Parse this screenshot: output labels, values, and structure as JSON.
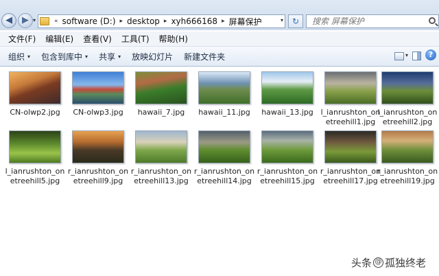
{
  "window": {
    "minimize": "–",
    "maximize": "□",
    "close": "✕"
  },
  "nav": {
    "back_glyph": "◀",
    "forward_glyph": "▶",
    "history_glyph": "▾"
  },
  "address": {
    "prefix": "«",
    "crumbs": [
      "software (D:)",
      "desktop",
      "xyh666168",
      "屏幕保护"
    ],
    "separator": "▸",
    "dropdown_glyph": "▾"
  },
  "refresh_glyph": "↻",
  "search": {
    "placeholder": "搜索 屏幕保护"
  },
  "menu": [
    "文件(F)",
    "编辑(E)",
    "查看(V)",
    "工具(T)",
    "帮助(H)"
  ],
  "toolbar": {
    "organize": "组织",
    "include_in_library": "包含到库中",
    "share": "共享",
    "slideshow": "放映幻灯片",
    "new_folder": "新建文件夹",
    "caret": "▾",
    "help_glyph": "?"
  },
  "files": [
    {
      "name": "CN-olwp2.jpg",
      "thumb": "t1"
    },
    {
      "name": "CN-olwp3.jpg",
      "thumb": "t2"
    },
    {
      "name": "hawaii_7.jpg",
      "thumb": "t3"
    },
    {
      "name": "hawaii_11.jpg",
      "thumb": "t4"
    },
    {
      "name": "hawaii_13.jpg",
      "thumb": "t5"
    },
    {
      "name": "l_ianrushton_onetreehill1.jpg",
      "thumb": "t6"
    },
    {
      "name": "l_ianrushton_onetreehill2.jpg",
      "thumb": "t7"
    },
    {
      "name": "l_ianrushton_onetreehill5.jpg",
      "thumb": "t8"
    },
    {
      "name": "r_ianrushton_onetreehill9.jpg",
      "thumb": "t9"
    },
    {
      "name": "r_ianrushton_onetreehill13.jpg",
      "thumb": "t10"
    },
    {
      "name": "r_ianrushton_onetreehill14.jpg",
      "thumb": "t11"
    },
    {
      "name": "r_ianrushton_onetreehill15.jpg",
      "thumb": "t12"
    },
    {
      "name": "r_ianrushton_onetreehill17.jpg",
      "thumb": "t13"
    },
    {
      "name": "r_ianrushton_onetreehill19.jpg",
      "thumb": "t14"
    }
  ],
  "watermark": {
    "left": "头条",
    "at": "@",
    "right": "孤独终老"
  }
}
